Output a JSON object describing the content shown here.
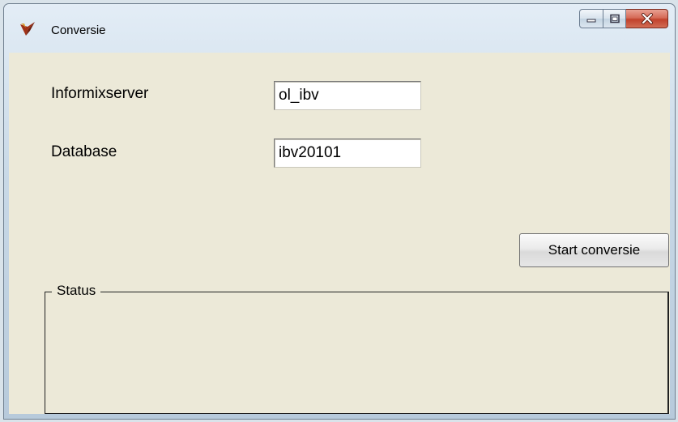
{
  "window": {
    "title": "Conversie",
    "icon": "app-logo-icon",
    "controls": [
      "minimize-icon",
      "maximize-icon",
      "close-icon"
    ]
  },
  "form": {
    "server_label": "Informixserver",
    "server_value": "ol_ibv",
    "database_label": "Database",
    "database_value": "ibv20101",
    "start_button": "Start conversie",
    "status_group": "Status"
  },
  "colors": {
    "client_bg": "#ece9d8",
    "close_button": "#c1422c"
  }
}
